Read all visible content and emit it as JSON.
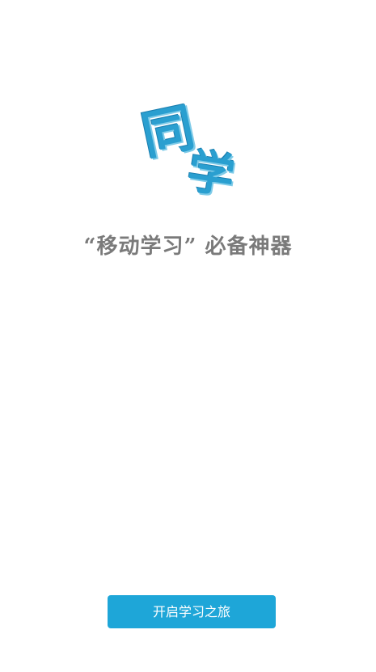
{
  "logo": {
    "char1": "同",
    "char2": "学",
    "color": "#2a9fd0"
  },
  "tagline": "“移动学习” 必备神器",
  "start_button": {
    "label": "开启学习之旅",
    "color": "#1ea6d8"
  }
}
